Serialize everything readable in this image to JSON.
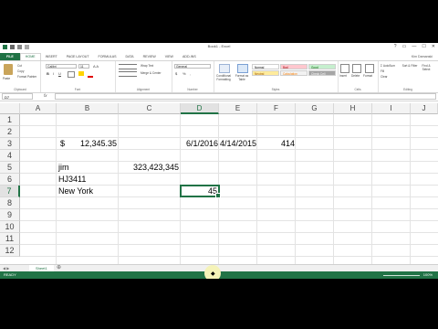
{
  "window": {
    "title": "Book1 - Excel",
    "user": "Kim Damanski",
    "controls": [
      "?",
      "▭",
      "—",
      "☐",
      "✕"
    ]
  },
  "ribbon_tabs": [
    "FILE",
    "HOME",
    "INSERT",
    "PAGE LAYOUT",
    "FORMULAS",
    "DATA",
    "REVIEW",
    "VIEW",
    "ADD-INS"
  ],
  "ribbon": {
    "clipboard": {
      "paste": "Paste",
      "cut": "Cut",
      "copy": "Copy",
      "format_painter": "Format Painter",
      "label": "Clipboard"
    },
    "font": {
      "name": "Calibri",
      "size": "11",
      "bold": "B",
      "italic": "I",
      "underline": "U",
      "label": "Font"
    },
    "alignment": {
      "wrap": "Wrap Text",
      "merge": "Merge & Center",
      "label": "Alignment"
    },
    "number": {
      "format": "General",
      "currency": "$",
      "percent": "%",
      "comma": ",",
      "label": "Number"
    },
    "styles": {
      "conditional": "Conditional Formatting",
      "format_table": "Format as Table",
      "cells": [
        "Normal",
        "Bad",
        "Good",
        "Neutral",
        "Calculation",
        "Check Cell"
      ],
      "label": "Styles"
    },
    "cells": {
      "insert": "Insert",
      "delete": "Delete",
      "format": "Format",
      "label": "Cells"
    },
    "editing": {
      "autosum": "AutoSum",
      "fill": "Fill",
      "clear": "Clear",
      "sort": "Sort & Filter",
      "find": "Find & Select",
      "label": "Editing"
    }
  },
  "formula_bar": {
    "name_box": "D7",
    "fx": "fx",
    "value": ""
  },
  "columns": [
    "A",
    "B",
    "C",
    "D",
    "E",
    "F",
    "G",
    "H",
    "I",
    "J"
  ],
  "selected_column": "D",
  "rows": [
    "1",
    "2",
    "3",
    "4",
    "5",
    "6",
    "7",
    "8",
    "9",
    "10",
    "11",
    "12"
  ],
  "selected_row": "7",
  "cells": {
    "B3_symbol": "$",
    "B3_value": "12,345.35",
    "D3": "6/1/2016",
    "E3": "4/14/2015",
    "F3": "414",
    "B5": "jim",
    "C5": "323,423,345",
    "B6": "HJ3411",
    "B7": "New York",
    "D7": "45"
  },
  "sheet_tabs": [
    "Sheet1"
  ],
  "status": {
    "left": "READY",
    "zoom": "100%"
  },
  "colors": {
    "accent": "#217346",
    "file_tab": "#1f7244",
    "cursor_highlight": "#f5f3b8"
  }
}
